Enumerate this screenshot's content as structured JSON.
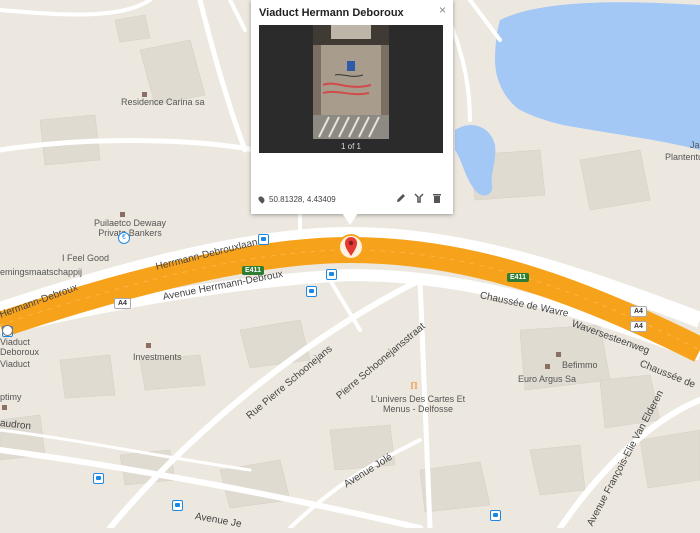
{
  "popup": {
    "title": "Viaduct Hermann Deboroux",
    "close_glyph": "×",
    "photo_counter": "1 of 1",
    "coordinates": "50.81328, 4.43409",
    "icons": [
      "location-pin-icon",
      "pencil-icon",
      "style-icon",
      "trash-icon"
    ]
  },
  "map": {
    "places": [
      {
        "name": "Residence Carina sa"
      },
      {
        "name": "Puilaetco Dewaay Private Bankers"
      },
      {
        "name": "I Feel Good"
      },
      {
        "name": "emingsmaatschappij"
      },
      {
        "name": "Viaduct Deboroux"
      },
      {
        "name": "Investments"
      },
      {
        "name": "L'univers Des Cartes Et Menus - Delfosse"
      },
      {
        "name": "Befimmo"
      },
      {
        "name": "Euro Argus Sa"
      },
      {
        "name": "Plantentuin"
      },
      {
        "name": "Ja"
      },
      {
        "name": "Viaduct"
      },
      {
        "name": "ptimy"
      }
    ],
    "roads": [
      {
        "name": "Herrmann-Debrouxlaan"
      },
      {
        "name": "Hermann-Debroux"
      },
      {
        "name": "Avenue Herrmann-Debroux"
      },
      {
        "name": "Chaussée de Wavre"
      },
      {
        "name": "Waversesteenweg"
      },
      {
        "name": "Chaussée de"
      },
      {
        "name": "Rue Pierre Schoonejans"
      },
      {
        "name": "Pierre Schoonejansstraat"
      },
      {
        "name": "Avenue Jolé"
      },
      {
        "name": "Avenue François-Elie Van Elderen"
      },
      {
        "name": "audron"
      },
      {
        "name": "Avenue Je"
      }
    ],
    "shields": [
      "E411",
      "E411",
      "A4",
      "A4",
      "A4"
    ],
    "colors": {
      "land": "#ece8df",
      "highway": "#f7a21b",
      "water": "#a4c8f6",
      "road": "#ffffff",
      "building": "#e0dbd1",
      "marker": "#e53935"
    }
  }
}
